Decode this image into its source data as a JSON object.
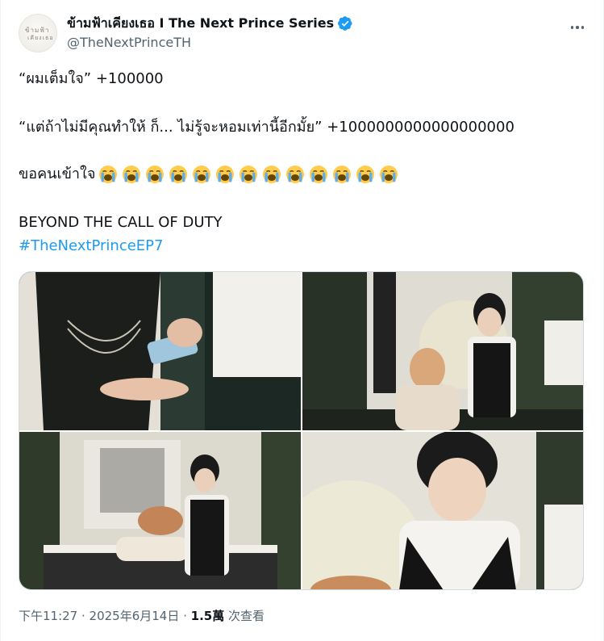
{
  "header": {
    "display_name": "ข้ามฟ้าเคียงเธอ I The Next Prince Series",
    "handle": "@TheNextPrinceTH",
    "avatar_text_1": "ข้ามฟ้า",
    "avatar_text_2": "เคียงเธอ"
  },
  "tweet": {
    "line1": "“ผมเต็มใจ” +100000",
    "line2": "“แต่ถ้าไม่มีคุณทำให้ ก็... ไม่รู้จะหอมเท่านี้อีกมั้ย” +1000000000000000000",
    "line3_text": "ขอคนเข้าใจ",
    "emoji_count": 13,
    "emoji_icon": "loudly-crying-face",
    "line4": "BEYOND THE CALL OF DUTY",
    "hashtag": "#TheNextPrinceEP7"
  },
  "meta": {
    "time": "下午11:27 · 2025年6月14日",
    "dot": " · ",
    "views_count": "1.5萬",
    "views_label": " 次查看"
  },
  "colors": {
    "accent": "#1d9bf0",
    "text": "#0f1419",
    "muted": "#536471"
  }
}
